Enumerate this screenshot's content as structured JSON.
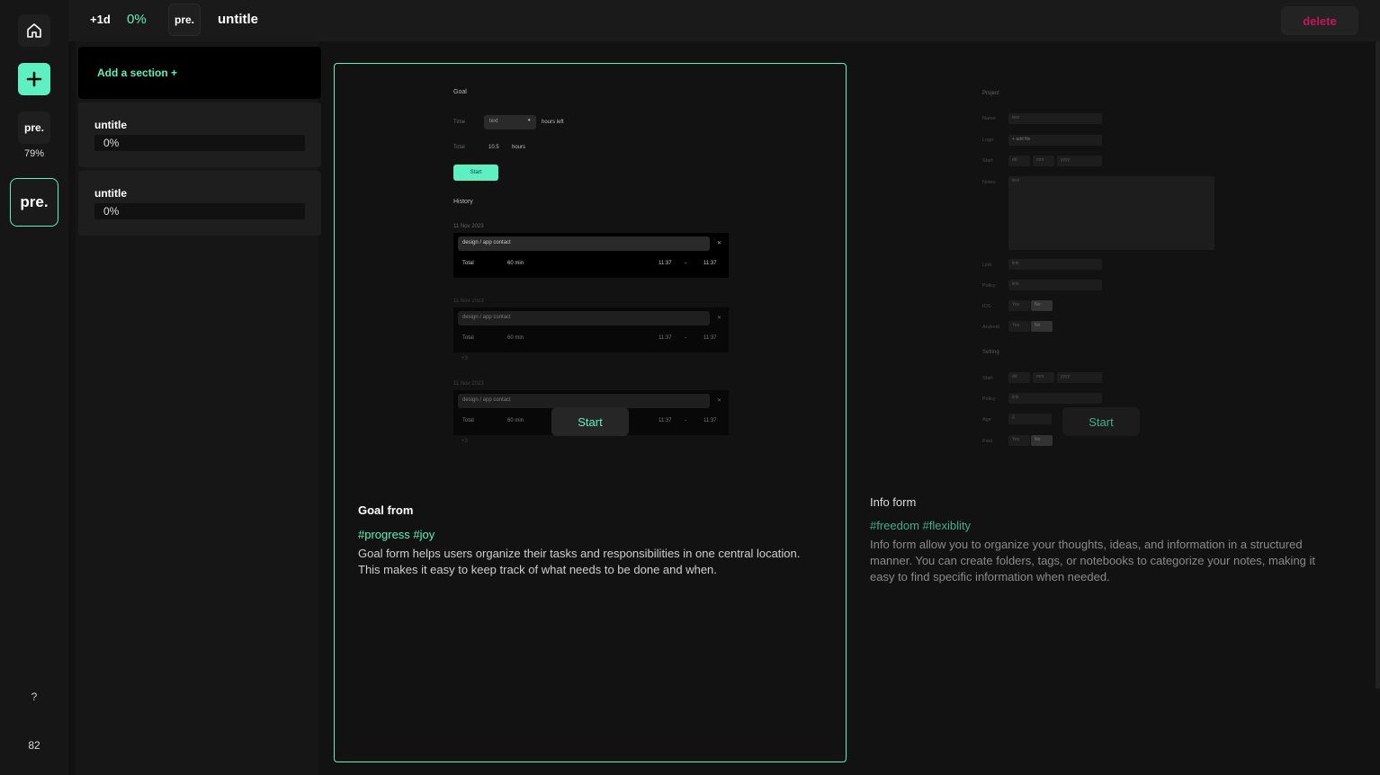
{
  "rail": {
    "project_logo": "pre.",
    "project_progress": "79%",
    "active_logo": "pre.",
    "help": "?",
    "count": "82"
  },
  "topbar": {
    "plus_day": "+1d",
    "progress": "0%",
    "logo": "pre.",
    "title": "untitle",
    "delete_label": "delete"
  },
  "sections": {
    "add_label": "Add a section +",
    "items": [
      {
        "title": "untitle",
        "progress": "0%"
      },
      {
        "title": "untitle",
        "progress": "0%"
      }
    ]
  },
  "templates": [
    {
      "name": "Goal from",
      "tags": "#progress #joy",
      "description": "Goal form helps users organize their tasks and responsibilities in one central location. This makes it easy to keep track of what needs to be done and when.",
      "start_label": "Start",
      "preview": {
        "heading": "Goal",
        "time_label": "Time",
        "time_value": "text",
        "time_unit": "hours left",
        "total_label": "Total",
        "total_value": "10.5",
        "total_unit": "hours",
        "start_button": "Start",
        "history_heading": "History",
        "history": [
          {
            "date": "11 Nov 2023",
            "task": "design / app contact",
            "total_label": "Total",
            "duration": "60 min",
            "from": "11:37",
            "sep": "-",
            "to": "11:37"
          },
          {
            "date": "11 Nov 2023",
            "task": "design / app contact",
            "total_label": "Total",
            "duration": "60 min",
            "from": "11:37",
            "sep": "-",
            "to": "11:37",
            "more": "+3"
          },
          {
            "date": "11 Nov 2023",
            "task": "design / app contact",
            "total_label": "Total",
            "duration": "60 min",
            "from": "11:37",
            "sep": "-",
            "to": "11:37",
            "more": "+3"
          }
        ]
      }
    },
    {
      "name": "Info form",
      "tags": "#freedom #flexiblity",
      "description": "Info form allow you to organize your thoughts, ideas, and information in a structured manner. You can create folders, tags, or notebooks to categorize your notes, making it easy to find specific information when needed.",
      "start_label": "Start",
      "preview": {
        "heading": "Project",
        "name_label": "Name",
        "name_value": "text",
        "logo_label": "Logo",
        "logo_value": "+ add file",
        "start_label": "Start",
        "dd": "dd",
        "mm": "mm",
        "yyyy": "yyyy",
        "notes_label": "Notes",
        "notes_value": "text",
        "link_label": "Link",
        "link_value": "link",
        "policy_label": "Policy",
        "policy_value": "link",
        "ios_label": "IOS",
        "yes": "Yes",
        "no": "No",
        "android_label": "Android",
        "setting_heading": "Setting",
        "age_label": "Age",
        "age_value": "0",
        "paid_label": "Paid"
      }
    }
  ]
}
